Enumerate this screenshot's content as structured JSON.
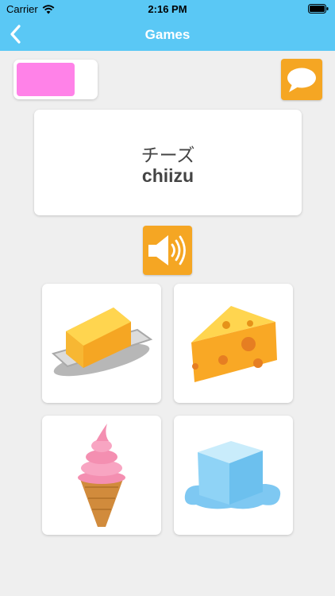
{
  "status_bar": {
    "carrier": "Carrier",
    "time": "2:16 PM"
  },
  "nav": {
    "title": "Games",
    "back_icon": "chevron-left-icon"
  },
  "progress": {
    "fraction": 0.74,
    "color": "#ff82e8"
  },
  "chat_button": {
    "icon": "speech-bubble-icon",
    "color": "#f5a623"
  },
  "word": {
    "kana": "チーズ",
    "romaji": "chiizu"
  },
  "sound_button": {
    "icon": "speaker-icon",
    "color": "#f5a623"
  },
  "choices": [
    {
      "name": "butter",
      "icon": "butter-icon"
    },
    {
      "name": "cheese",
      "icon": "cheese-icon"
    },
    {
      "name": "ice-cream",
      "icon": "ice-cream-icon"
    },
    {
      "name": "ice-cube",
      "icon": "ice-cube-icon"
    }
  ],
  "colors": {
    "accent": "#5ac8f5",
    "background": "#efefef"
  }
}
